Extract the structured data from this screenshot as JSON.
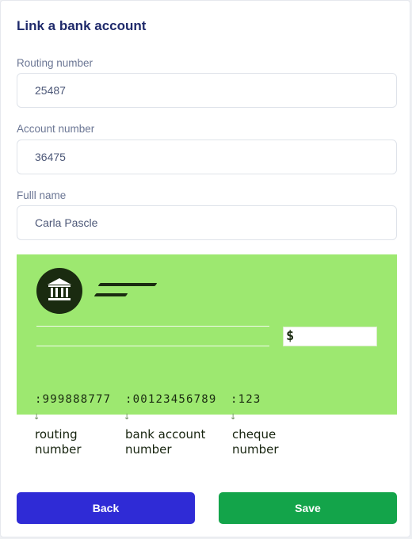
{
  "header": {
    "title": "Link a bank account"
  },
  "form": {
    "routing": {
      "label": "Routing number",
      "value": "25487"
    },
    "account": {
      "label": "Account number",
      "value": "36475"
    },
    "name": {
      "label": "Fulll name",
      "value": "Carla Pascle"
    }
  },
  "cheque": {
    "background_color": "#9de870",
    "ink_color": "#1a2b10",
    "bank_icon": "bank-icon",
    "dollar_symbol": "$",
    "micr": {
      "routing": ":999888777",
      "account": ":00123456789",
      "cheque": ":123"
    }
  },
  "legend": {
    "arrow": "↓",
    "routing": {
      "line1": "routing",
      "line2": "number"
    },
    "account": {
      "line1": "bank account",
      "line2": "number"
    },
    "cheque": {
      "line1": "cheque",
      "line2": "number"
    }
  },
  "actions": {
    "back_label": "Back",
    "save_label": "Save",
    "back_color": "#2f2bd6",
    "save_color": "#13a44a"
  }
}
